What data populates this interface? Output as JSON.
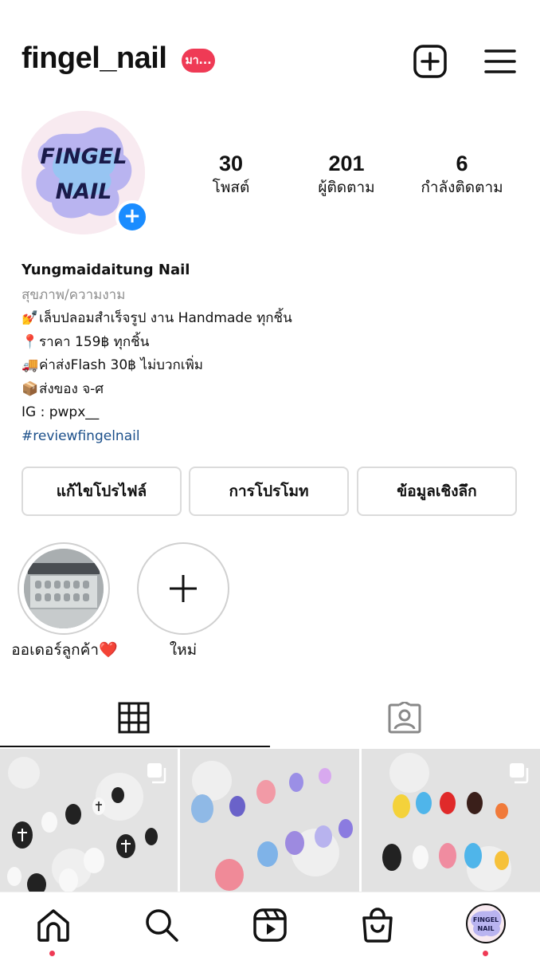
{
  "header": {
    "username": "fingel_nail",
    "badge": "มา...",
    "icons": [
      "plus-square-icon",
      "hamburger-menu-icon"
    ]
  },
  "profile": {
    "avatar_text_line1": "FINGEL",
    "avatar_text_line2": "NAIL",
    "stats": [
      {
        "value": "30",
        "label": "โพสต์"
      },
      {
        "value": "201",
        "label": "ผู้ติดตาม"
      },
      {
        "value": "6",
        "label": "กำลังติดตาม"
      }
    ]
  },
  "bio": {
    "name": "Yungmaidaitung Nail",
    "category": "สุขภาพ/ความงาม",
    "lines": [
      {
        "emoji": "💅",
        "text": "เล็บปลอมสำเร็จรูป งาน Handmade ทุกชิ้น"
      },
      {
        "emoji": "📍",
        "text": "ราคา 159฿ ทุกชิ้น"
      },
      {
        "emoji": "🚚",
        "text": "ค่าส่งFlash 30฿ ไม่บวกเพิ่ม"
      },
      {
        "emoji": "📦",
        "text": "ส่งของ จ-ศ"
      }
    ],
    "ig": "IG : pwpx__",
    "hashtag": "#reviewfingelnail"
  },
  "buttons": {
    "edit_profile": "แก้ไขโปรไฟล์",
    "promote": "การโปรโมท",
    "insights": "ข้อมูลเชิงลึก"
  },
  "highlights": [
    {
      "label": "ออเดอร์ลูกค้า",
      "heart": "❤️"
    },
    {
      "label": "ใหม่"
    }
  ],
  "tabs": [
    "grid-icon",
    "tagged-person-icon"
  ],
  "nav": [
    "home-icon",
    "search-icon",
    "reels-icon",
    "shop-icon",
    "profile-avatar"
  ],
  "colors": {
    "accent_blue": "#1a8cff",
    "notification_red": "#ef3a55",
    "hashtag_blue": "#1b4f8a",
    "muted_gray": "#8e8e8e"
  }
}
